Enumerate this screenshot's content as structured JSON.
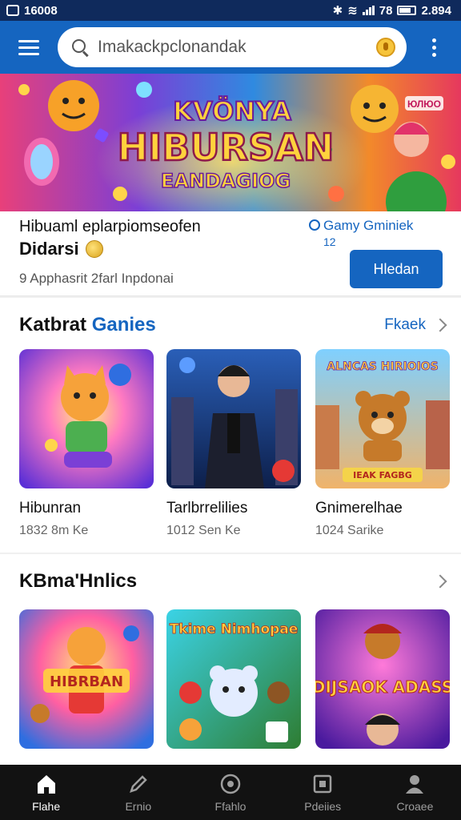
{
  "status_bar": {
    "time": "16008",
    "battery_text": "78",
    "clock_right": "2.894"
  },
  "search": {
    "placeholder": "Imakackpclonandak"
  },
  "hero": {
    "line1": "KVÖNYA",
    "line2": "HIBURSAN",
    "line3": "EANDAGIOG",
    "badge": "ЮЛЮО"
  },
  "info": {
    "title": "Hibuaml eplarpiomseofen",
    "subtitle": "Didarsi",
    "meta": "9 Apphasrit 2farl Inpdonai",
    "link_text": "Gamy Gminiek",
    "link_sub": "12",
    "button_label": "Hledan"
  },
  "section1": {
    "title_plain": "Katbrat ",
    "title_accent": "Ganies",
    "see_more": "Fkaek",
    "items": [
      {
        "name": "Hibunran",
        "meta": "1832 8m Ke"
      },
      {
        "name": "Tarlbrrelilies",
        "meta": "1012 Sen Ke"
      },
      {
        "name": "Gnimerelhae",
        "meta": "1024 Sarike"
      }
    ]
  },
  "section2": {
    "title": "KBma'Hnlics",
    "items": [
      {
        "art_text": "HIBRBAN"
      },
      {
        "art_text": "Tkime Nimhopae"
      },
      {
        "art_text": "DIJSAOK ADASS"
      }
    ]
  },
  "thumb_texts": {
    "item3_top": "ALNCAS HIRIOIOS",
    "item3_bottom": "IEAK FAGBG"
  },
  "bottom_nav": [
    {
      "label": "Flahe",
      "icon": "home-icon",
      "active": true
    },
    {
      "label": "Ernio",
      "icon": "pen-icon",
      "active": false
    },
    {
      "label": "Ffahlo",
      "icon": "record-icon",
      "active": false
    },
    {
      "label": "Pdeiies",
      "icon": "tile-icon",
      "active": false
    },
    {
      "label": "Croaee",
      "icon": "profile-icon",
      "active": false
    }
  ],
  "colors": {
    "primary": "#1565c0",
    "status_bar": "#0f2a5c",
    "nav_bg": "#121212"
  }
}
